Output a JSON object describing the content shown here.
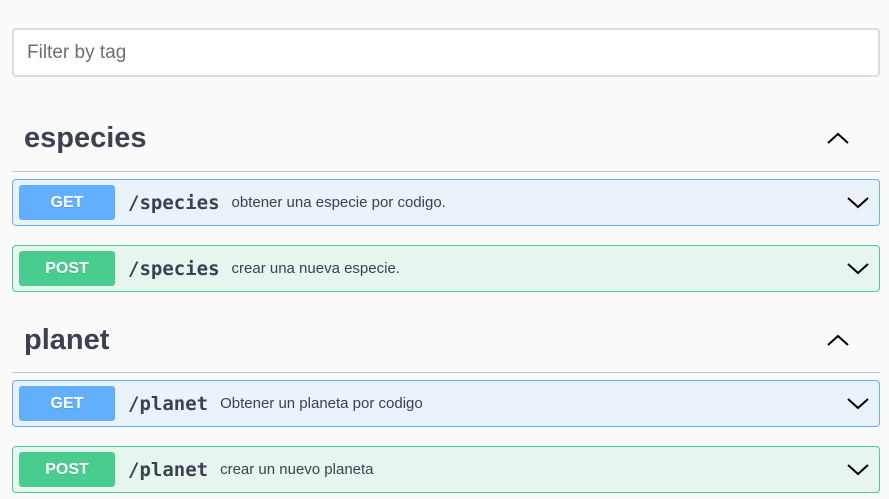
{
  "filter": {
    "placeholder": "Filter by tag",
    "value": ""
  },
  "tags": [
    {
      "name": "especies",
      "toggle_icon": "chevron-up-icon",
      "operations": [
        {
          "method": "GET",
          "path": "/species",
          "summary": "obtener una especie por codigo.",
          "expand_icon": "chevron-down-icon"
        },
        {
          "method": "POST",
          "path": "/species",
          "summary": "crear una nueva especie.",
          "expand_icon": "chevron-down-icon"
        }
      ]
    },
    {
      "name": "planet",
      "toggle_icon": "chevron-up-icon",
      "operations": [
        {
          "method": "GET",
          "path": "/planet",
          "summary": "Obtener un planeta por codigo",
          "expand_icon": "chevron-down-icon"
        },
        {
          "method": "POST",
          "path": "/planet",
          "summary": "crear un nuevo planeta",
          "expand_icon": "chevron-down-icon"
        }
      ]
    }
  ],
  "colors": {
    "get": "#61affe",
    "post": "#49cc90",
    "text": "#3b4151",
    "background": "#fafafa"
  }
}
